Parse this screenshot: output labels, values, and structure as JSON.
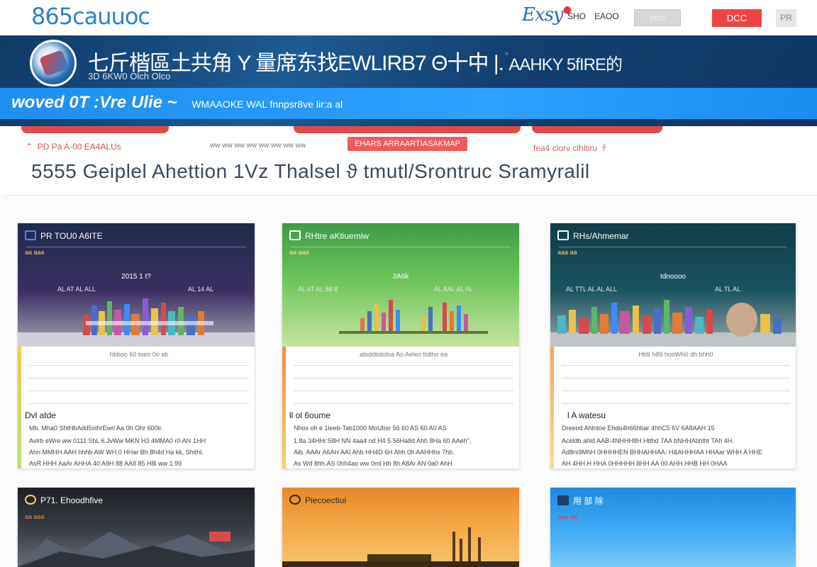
{
  "header": {
    "logo": "865cauuoc",
    "brand": "Exsy",
    "links": [
      "SHO",
      "EAOO"
    ],
    "btn_grey": "clco",
    "btn_red": "DCC",
    "btn_square": "PR"
  },
  "hero": {
    "title": "七斤楷區土共角 Y 量席东找EWLIRB7 Θ十中 |.",
    "title_right": "AAHKY 5fIRE的",
    "subtitle": "3D 6KW0 Olch Olco",
    "band_main": "woved 0T :Vre Ulie ~",
    "band_small": "WMAAOKE WAL  fnnpsr8ve  lir:a al"
  },
  "nav": {
    "items": [
      {
        "label": "PD Pà A·00 EA4ALUs",
        "style": "normal"
      },
      {
        "label": "ww ww ww ww ww ww ww ww",
        "style": "muted"
      },
      {
        "label": "EHARS ARRAARTIASAKMAP",
        "style": "active"
      },
      {
        "label": "fea4 clorv clhltiru",
        "style": "normal"
      }
    ]
  },
  "page": {
    "title": "5555 Geiplel Ahettion 1Vz Thalsel  ϑ tmutl/Srontruc Sramyralil"
  },
  "cards": [
    {
      "title": "PR   TOU0 A6ITE",
      "sub": "aa aaa",
      "mid": "2015 1 t?",
      "micro_left": "AL AT AL ALL",
      "micro_right": "AL 14 AL",
      "caption": "hbboo 60 toeo 0o ab",
      "label": "Dvl atde",
      "lines": [
        "Mb. Mha0 ShtHbAdd5sthrEwrl Aa 0h Ohr 600lr.",
        "Avlrb eWre ww 0111 ShL 6.JvWw MKN H3 4MMA0 r0 Ahi 1HH",
        "Ahn MMHH AAH hhhb AW WH.0 HHar Bh 8h4d Ha kk, Shithl.",
        "AsR HHH AaAr AHHA 40 A9H 88 AA8 85 H8l ww 1 99"
      ]
    },
    {
      "title": "RHtre aKtiuemiw",
      "sub": "aa aaa",
      "mid": "2A6k",
      "micro_left": "AL AT AL 88 8",
      "micro_right": "AL AAL AL AL",
      "caption": "abiddtotidoa Ao Aeleo tldtho ea",
      "label": "ll ol 6oume",
      "lines": [
        "Nhos oh e 1leeb-Tab1000 MoUbsr 56 60 AS 60 A0 AS",
        "1.8a 34HHr:58H NN 4aa4 nd H4 5 56Ha8d Ahh 8Ha 60 AAeh\",",
        "Aib. AAAr A6AH AAI Ahb HH4D 6H Ahh 0h AAHHhs 7hb.",
        "As Wd 8hh.AS 0hh4ao ww 0ml Hh 8h A8Ar AN 0a0 AhH"
      ]
    },
    {
      "title": "RHs/Ahmemar",
      "sub": "aaa aa",
      "mid": "Idnoooo",
      "micro_left": "AL TTL AL AL ALL",
      "micro_right": "AL TL AL",
      "caption": "Hb9 h89 hooWh0 dh bhh0",
      "label": "l A watesu",
      "lines": [
        "Dreeod Ahlntoe Ehdo4h66hbar 4hhC5 6V 6A8AAH 15",
        "Aceldb ahld AAB-4NHHH8H Htthd 7AA bNHHAbhlht TAh 4H.",
        "Ad8rs9MhH 0HHHHEN BHHAHHAA: H&AHHHAA HHAar WHH A HHE",
        "AH 4HH.H HHA 0HHHHH 8HH AA 00 AHH HHB HH 0HAA"
      ]
    },
    {
      "title": "P71. Ehoodhfive",
      "sub": "aa aaa"
    },
    {
      "title": "Piecoectiui",
      "sub": ""
    },
    {
      "title": "用 部 除",
      "sub": "aaa aa"
    }
  ]
}
